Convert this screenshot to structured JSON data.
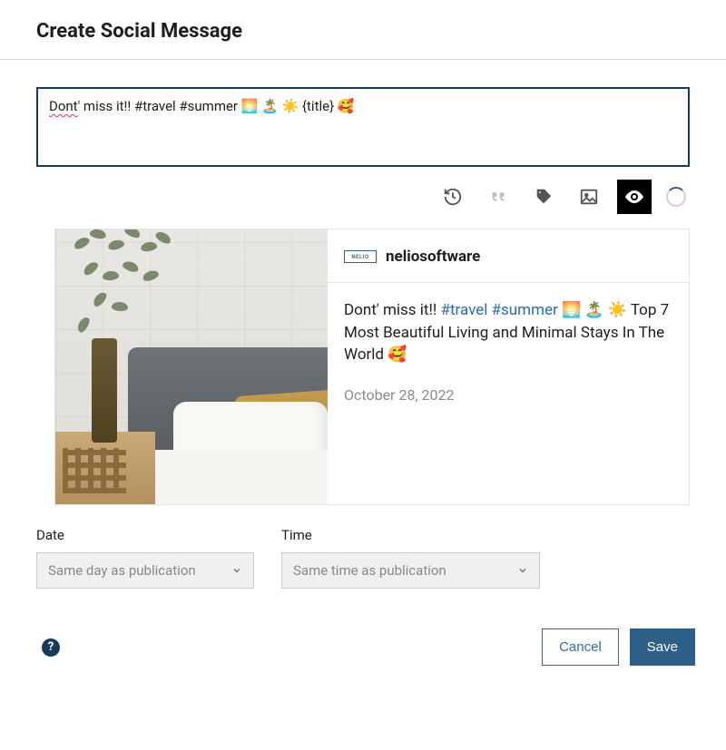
{
  "header": {
    "title": "Create Social Message"
  },
  "message": {
    "text_prefix_typo": "Dont",
    "text_rest": "' miss it!! #travel #summer 🌅 🏝️ ☀️ {title} 🥰"
  },
  "toolbar": {
    "history": "history-icon",
    "quote": "quote-icon",
    "tag": "tag-icon",
    "image": "image-icon",
    "preview": "preview-eye-icon"
  },
  "preview": {
    "logo_text": "NELIO",
    "username": "neliosoftware",
    "body_plain": "Dont' miss it!! ",
    "body_hashtags": "#travel #summer",
    "body_emojis1": " 🌅 🏝️ ☀️ ",
    "body_title": "Top 7 Most Beautiful Living and Minimal Stays In The World ",
    "body_emoji2": "🥰",
    "date": "October 28, 2022"
  },
  "fields": {
    "date_label": "Date",
    "date_value": "Same day as publication",
    "time_label": "Time",
    "time_value": "Same time as publication"
  },
  "footer": {
    "help": "?",
    "cancel": "Cancel",
    "save": "Save"
  }
}
